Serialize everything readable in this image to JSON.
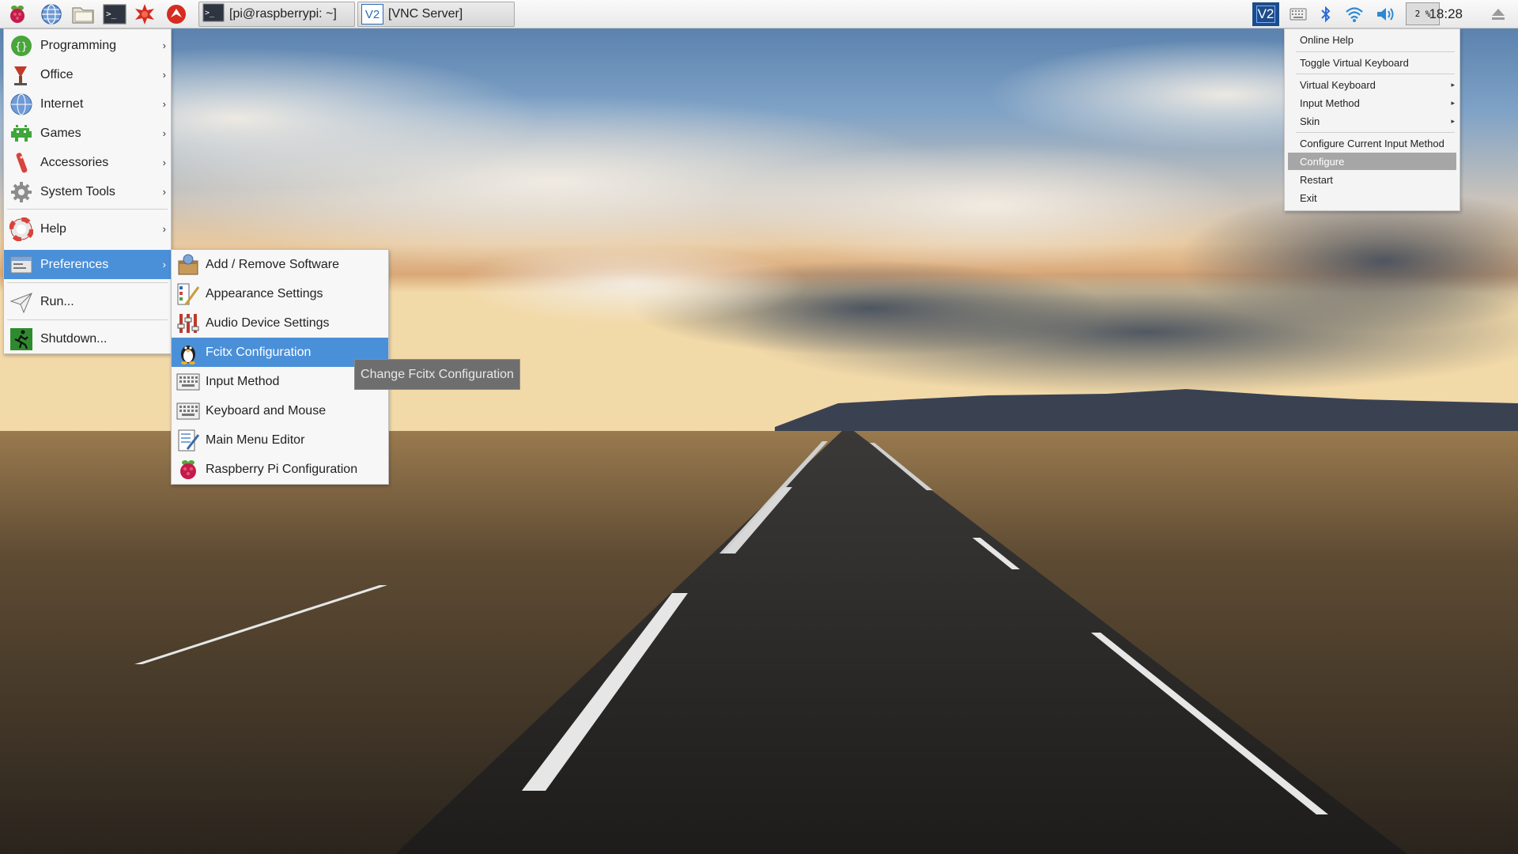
{
  "panel": {
    "launchers": [
      "raspberry-menu-icon",
      "web-browser-icon",
      "file-manager-icon",
      "terminal-icon",
      "mathematica-icon",
      "wolfram-icon"
    ],
    "tasks": [
      {
        "label": "[pi@raspberrypi: ~]",
        "icon": "terminal-icon"
      },
      {
        "label": "[VNC Server]",
        "icon": "vnc-icon",
        "icon_text": "V2"
      }
    ],
    "tray": {
      "vnc_icon_text": "V2",
      "cpu_percent": "2 %",
      "clock": "18:28"
    }
  },
  "main_menu": {
    "items": [
      {
        "label": "Programming",
        "icon": "programming-icon",
        "has_submenu": true
      },
      {
        "label": "Office",
        "icon": "office-icon",
        "has_submenu": true
      },
      {
        "label": "Internet",
        "icon": "internet-icon",
        "has_submenu": true
      },
      {
        "label": "Games",
        "icon": "games-icon",
        "has_submenu": true
      },
      {
        "label": "Accessories",
        "icon": "accessories-icon",
        "has_submenu": true
      },
      {
        "label": "System Tools",
        "icon": "system-tools-icon",
        "has_submenu": true
      },
      {
        "label": "Help",
        "icon": "help-icon",
        "has_submenu": true
      },
      {
        "label": "Preferences",
        "icon": "preferences-icon",
        "has_submenu": true,
        "active": true
      },
      {
        "label": "Run...",
        "icon": "run-icon",
        "has_submenu": false
      },
      {
        "label": "Shutdown...",
        "icon": "shutdown-icon",
        "has_submenu": false
      }
    ],
    "arrow": "›"
  },
  "preferences_menu": {
    "items": [
      {
        "label": "Add / Remove Software",
        "icon": "package-icon"
      },
      {
        "label": "Appearance Settings",
        "icon": "appearance-icon"
      },
      {
        "label": "Audio Device Settings",
        "icon": "audio-mixer-icon"
      },
      {
        "label": "Fcitx Configuration",
        "icon": "penguin-icon",
        "active": true
      },
      {
        "label": "Input Method",
        "icon": "keyboard-icon"
      },
      {
        "label": "Keyboard and Mouse",
        "icon": "keyboard-icon"
      },
      {
        "label": "Main Menu Editor",
        "icon": "menu-editor-icon"
      },
      {
        "label": "Raspberry Pi Configuration",
        "icon": "raspberry-icon"
      }
    ]
  },
  "tooltip": {
    "text": "Change Fcitx Configuration"
  },
  "fcitx_menu": {
    "items": [
      {
        "label": "Online Help"
      },
      {
        "label": "Toggle Virtual Keyboard"
      },
      {
        "label": "Virtual Keyboard",
        "has_submenu": true
      },
      {
        "label": "Input Method",
        "has_submenu": true
      },
      {
        "label": "Skin",
        "has_submenu": true
      },
      {
        "label": "Configure Current Input Method"
      },
      {
        "label": "Configure",
        "active": true
      },
      {
        "label": "Restart"
      },
      {
        "label": "Exit"
      }
    ],
    "arrow": "▸"
  },
  "colors": {
    "menu_highlight": "#4a90d9",
    "fcitx_highlight": "#a6a6a6",
    "tooltip_bg": "#6e6e6e"
  }
}
